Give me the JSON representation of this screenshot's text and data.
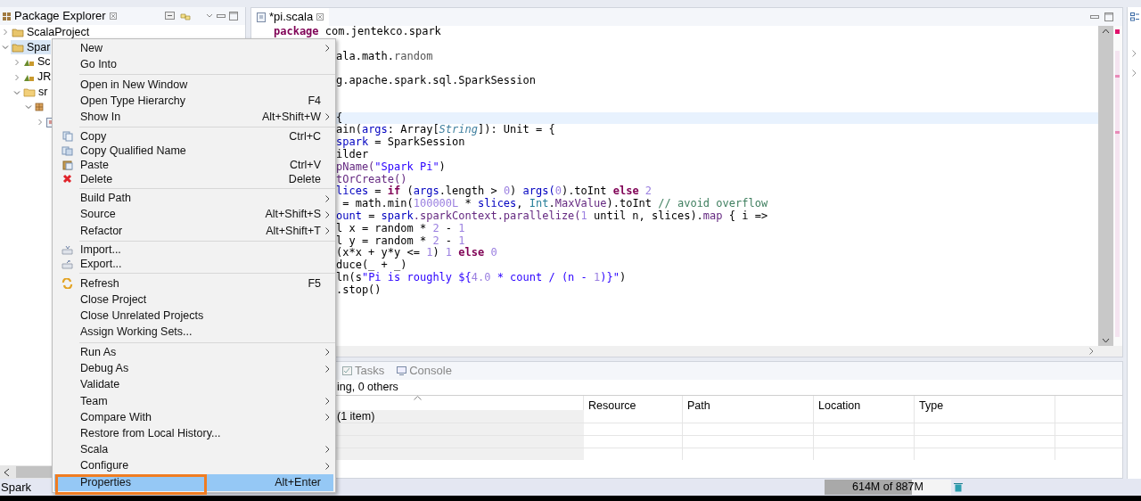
{
  "explorer": {
    "title": "Package Explorer",
    "tree": [
      {
        "label": "ScalaProject",
        "expanded": false,
        "selected": false,
        "kind": "project"
      },
      {
        "label": "Spar",
        "expanded": true,
        "selected": true,
        "kind": "project",
        "children": [
          {
            "label": "Sc",
            "expanded": false,
            "selected": false,
            "kind": "library"
          },
          {
            "label": "JR",
            "expanded": false,
            "selected": false,
            "kind": "library"
          },
          {
            "label": "sr",
            "expanded": true,
            "selected": false,
            "kind": "folder",
            "children": [
              {
                "expanded": true,
                "selected": false,
                "kind": "package",
                "children": [
                  {
                    "expanded": false,
                    "selected": false,
                    "kind": "file"
                  }
                ]
              }
            ]
          }
        ]
      }
    ]
  },
  "editor": {
    "tab": {
      "title": "*pi.scala"
    },
    "package_line": [
      {
        "text": "package",
        "kind": "kw"
      },
      {
        "text": " com.jentekco.spark",
        "kind": "plain"
      }
    ],
    "lines": [
      {
        "kind": "code",
        "current": false,
        "segments": [
          {
            "text": "ala.math.",
            "kind": "plain"
          },
          {
            "text": "random",
            "kind": "dim"
          }
        ]
      },
      {
        "kind": "blank",
        "current": false
      },
      {
        "kind": "code",
        "current": false,
        "segments": [
          {
            "text": "g.apache.spark.sql.SparkSession",
            "kind": "plain"
          }
        ]
      },
      {
        "kind": "blank",
        "current": false
      },
      {
        "kind": "blank",
        "current": false
      },
      {
        "kind": "code",
        "current": true,
        "segments": [
          {
            "text": "{",
            "kind": "plain"
          }
        ]
      },
      {
        "kind": "code",
        "current": false,
        "segments": [
          {
            "text": "ain(",
            "kind": "plain"
          },
          {
            "text": "args",
            "kind": "field"
          },
          {
            "text": ": Array[",
            "kind": "plain"
          },
          {
            "text": "String",
            "kind": "type"
          },
          {
            "text": "]): Unit = {",
            "kind": "plain"
          }
        ]
      },
      {
        "kind": "code",
        "current": false,
        "segments": [
          {
            "text": "spark",
            "kind": "field"
          },
          {
            "text": " = SparkSession",
            "kind": "plain"
          }
        ]
      },
      {
        "kind": "code",
        "current": false,
        "segments": [
          {
            "text": "ilder",
            "kind": "plain"
          }
        ]
      },
      {
        "kind": "code",
        "current": false,
        "segments": [
          {
            "text": "pName(",
            "kind": "method"
          },
          {
            "text": "\"Spark Pi\"",
            "kind": "str"
          },
          {
            "text": ")",
            "kind": "plain"
          }
        ]
      },
      {
        "kind": "code",
        "current": false,
        "segments": [
          {
            "text": "tOrCreate()",
            "kind": "method"
          }
        ]
      },
      {
        "kind": "code",
        "current": false,
        "segments": [
          {
            "text": "lices",
            "kind": "field"
          },
          {
            "text": " = ",
            "kind": "plain"
          },
          {
            "text": "if",
            "kind": "kw"
          },
          {
            "text": " (",
            "kind": "plain"
          },
          {
            "text": "args",
            "kind": "field"
          },
          {
            "text": ".length > ",
            "kind": "plain"
          },
          {
            "text": "0",
            "kind": "num"
          },
          {
            "text": ") ",
            "kind": "plain"
          },
          {
            "text": "args(",
            "kind": "field"
          },
          {
            "text": "0",
            "kind": "num"
          },
          {
            "text": ").toInt ",
            "kind": "plain"
          },
          {
            "text": "else",
            "kind": "kw"
          },
          {
            "text": " 2",
            "kind": "num"
          }
        ]
      },
      {
        "kind": "code",
        "current": false,
        "segments": [
          {
            "text": " = math.min(",
            "kind": "plain"
          },
          {
            "text": "100000L",
            "kind": "num"
          },
          {
            "text": " * ",
            "kind": "plain"
          },
          {
            "text": "slices",
            "kind": "field"
          },
          {
            "text": ", ",
            "kind": "plain"
          },
          {
            "text": "Int",
            "kind": "type2"
          },
          {
            "text": ".",
            "kind": "plain"
          },
          {
            "text": "MaxValue",
            "kind": "method"
          },
          {
            "text": ").toInt ",
            "kind": "plain"
          },
          {
            "text": "// avoid overflow",
            "kind": "comment"
          }
        ]
      },
      {
        "kind": "code",
        "current": false,
        "segments": [
          {
            "text": "ount",
            "kind": "field"
          },
          {
            "text": " = ",
            "kind": "plain"
          },
          {
            "text": "spark",
            "kind": "field"
          },
          {
            "text": ".sparkContext.parallelize(",
            "kind": "method"
          },
          {
            "text": "1",
            "kind": "num"
          },
          {
            "text": " until n, slices).",
            "kind": "plain"
          },
          {
            "text": "map",
            "kind": "method"
          },
          {
            "text": " { i =>",
            "kind": "plain"
          }
        ]
      },
      {
        "kind": "code",
        "current": false,
        "segments": [
          {
            "text": "l x = random * ",
            "kind": "plain"
          },
          {
            "text": "2",
            "kind": "num"
          },
          {
            "text": " - ",
            "kind": "plain"
          },
          {
            "text": "1",
            "kind": "num"
          }
        ]
      },
      {
        "kind": "code",
        "current": false,
        "segments": [
          {
            "text": "l y = random * ",
            "kind": "plain"
          },
          {
            "text": "2",
            "kind": "num"
          },
          {
            "text": " - ",
            "kind": "plain"
          },
          {
            "text": "1",
            "kind": "num"
          }
        ]
      },
      {
        "kind": "code",
        "current": false,
        "segments": [
          {
            "text": "(x*x + y*y <= ",
            "kind": "plain"
          },
          {
            "text": "1",
            "kind": "num"
          },
          {
            "text": ") ",
            "kind": "plain"
          },
          {
            "text": "1 ",
            "kind": "num"
          },
          {
            "text": "else",
            "kind": "kw"
          },
          {
            "text": " 0",
            "kind": "num"
          }
        ]
      },
      {
        "kind": "code",
        "current": false,
        "segments": [
          {
            "text": "duce(_ + _)",
            "kind": "plain"
          }
        ]
      },
      {
        "kind": "code",
        "current": false,
        "segments": [
          {
            "text": "ln(s",
            "kind": "plain"
          },
          {
            "text": "\"Pi is roughly ${",
            "kind": "str"
          },
          {
            "text": "4.0",
            "kind": "num"
          },
          {
            "text": " * count / (n - ",
            "kind": "str"
          },
          {
            "text": "1",
            "kind": "num"
          },
          {
            "text": ")}\"",
            "kind": "str"
          },
          {
            "text": ")",
            "kind": "plain"
          }
        ]
      },
      {
        "kind": "code",
        "current": false,
        "segments": [
          {
            "text": ".stop()",
            "kind": "plain"
          }
        ]
      }
    ]
  },
  "bottom_panel": {
    "tabs": [
      {
        "label": "Tasks",
        "kind": "tasks",
        "selected": false
      },
      {
        "label": "Console",
        "kind": "console",
        "selected": false
      }
    ],
    "summary": "ing, 0 others",
    "table": {
      "first_column": {
        "sort_indicator": true
      },
      "columns": [
        "Resource",
        "Path",
        "Location",
        "Type"
      ],
      "rows": [
        {
          "column_1": "(1 item)"
        }
      ]
    }
  },
  "context_menu": {
    "items": [
      {
        "kind": "plain",
        "label": "New",
        "submenu": true,
        "selected": false,
        "outlined": false
      },
      {
        "kind": "plain",
        "label": "Go Into",
        "submenu": false,
        "selected": false,
        "outlined": false
      },
      {
        "kind": "separator"
      },
      {
        "kind": "plain",
        "label": "Open in New Window",
        "submenu": false,
        "selected": false,
        "outlined": false
      },
      {
        "kind": "plain",
        "label": "Open Type Hierarchy",
        "shortcut": "F4",
        "submenu": false,
        "selected": false,
        "outlined": false
      },
      {
        "kind": "plain",
        "label": "Show In",
        "shortcut": "Alt+Shift+W",
        "submenu": true,
        "selected": false,
        "outlined": false
      },
      {
        "kind": "separator"
      },
      {
        "kind": "copy",
        "label": "Copy",
        "shortcut": "Ctrl+C",
        "submenu": false,
        "selected": false,
        "outlined": false
      },
      {
        "kind": "copy_name",
        "label": "Copy Qualified Name",
        "submenu": false,
        "selected": false,
        "outlined": false
      },
      {
        "kind": "paste",
        "label": "Paste",
        "shortcut": "Ctrl+V",
        "submenu": false,
        "selected": false,
        "outlined": false
      },
      {
        "kind": "delete",
        "label": "Delete",
        "shortcut": "Delete",
        "submenu": false,
        "selected": false,
        "outlined": false
      },
      {
        "kind": "separator"
      },
      {
        "kind": "plain",
        "label": "Build Path",
        "submenu": true,
        "selected": false,
        "outlined": false
      },
      {
        "kind": "plain",
        "label": "Source",
        "shortcut": "Alt+Shift+S",
        "submenu": true,
        "selected": false,
        "outlined": false
      },
      {
        "kind": "plain",
        "label": "Refactor",
        "shortcut": "Alt+Shift+T",
        "submenu": true,
        "selected": false,
        "outlined": false
      },
      {
        "kind": "separator"
      },
      {
        "kind": "import",
        "label": "Import...",
        "submenu": false,
        "selected": false,
        "outlined": false
      },
      {
        "kind": "export",
        "label": "Export...",
        "submenu": false,
        "selected": false,
        "outlined": false
      },
      {
        "kind": "separator"
      },
      {
        "kind": "refresh",
        "label": "Refresh",
        "shortcut": "F5",
        "submenu": false,
        "selected": false,
        "outlined": false
      },
      {
        "kind": "plain",
        "label": "Close Project",
        "submenu": false,
        "selected": false,
        "outlined": false
      },
      {
        "kind": "plain",
        "label": "Close Unrelated Projects",
        "submenu": false,
        "selected": false,
        "outlined": false
      },
      {
        "kind": "plain",
        "label": "Assign Working Sets...",
        "submenu": false,
        "selected": false,
        "outlined": false
      },
      {
        "kind": "separator"
      },
      {
        "kind": "plain",
        "label": "Run As",
        "submenu": true,
        "selected": false,
        "outlined": false
      },
      {
        "kind": "plain",
        "label": "Debug As",
        "submenu": true,
        "selected": false,
        "outlined": false
      },
      {
        "kind": "plain",
        "label": "Validate",
        "submenu": false,
        "selected": false,
        "outlined": false
      },
      {
        "kind": "plain",
        "label": "Team",
        "submenu": true,
        "selected": false,
        "outlined": false
      },
      {
        "kind": "plain",
        "label": "Compare With",
        "submenu": true,
        "selected": false,
        "outlined": false
      },
      {
        "kind": "plain",
        "label": "Restore from Local History...",
        "submenu": false,
        "selected": false,
        "outlined": false
      },
      {
        "kind": "plain",
        "label": "Scala",
        "submenu": true,
        "selected": false,
        "outlined": false
      },
      {
        "kind": "plain",
        "label": "Configure",
        "submenu": true,
        "selected": false,
        "outlined": false
      },
      {
        "kind": "plain",
        "label": "Properties",
        "shortcut": "Alt+Enter",
        "submenu": false,
        "selected": true,
        "outlined": true
      }
    ]
  },
  "status_bar": {
    "selection": "Spark",
    "memory": {
      "text": "614M of 887M",
      "level": 0.69
    }
  }
}
